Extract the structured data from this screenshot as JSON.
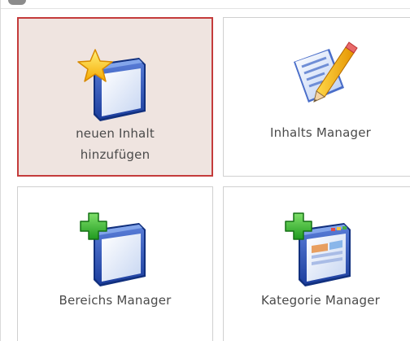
{
  "tiles": [
    {
      "label_line1": "neuen Inhalt",
      "label_line2": "hinzufügen",
      "icon": "new-window-star-icon",
      "active": true
    },
    {
      "label": "Inhalts Manager",
      "icon": "document-pencil-icon"
    },
    {
      "label": "Bereichs Manager",
      "icon": "window-plus-icon"
    },
    {
      "label": "Kategorie Manager",
      "icon": "app-window-plus-icon"
    }
  ],
  "colors": {
    "active_background": "#efe4e0",
    "active_border": "#c43b3b",
    "label_text": "#4a4a4a",
    "tile_border": "#d0d0d0"
  }
}
